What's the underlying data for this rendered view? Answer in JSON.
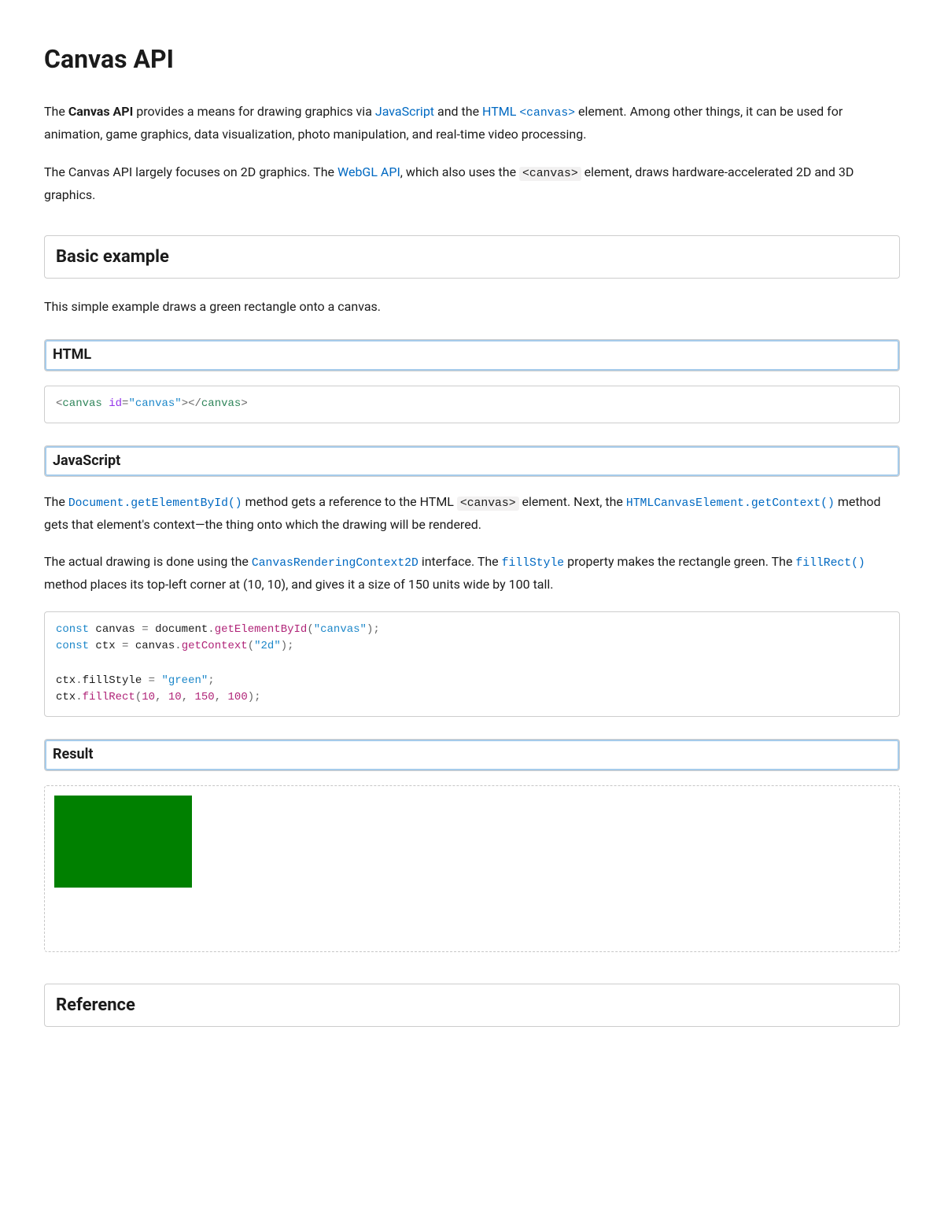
{
  "title": "Canvas API",
  "para1": {
    "t1": "The ",
    "b1": "Canvas API",
    "t2": " provides a means for drawing graphics via ",
    "link_js": "JavaScript",
    "t3": " and the ",
    "link_html": "HTML",
    "t4": " ",
    "code_canvas": "<canvas>",
    "t5": " element. Among other things, it can be used for animation, game graphics, data visualization, photo manipulation, and real-time video processing."
  },
  "para2": {
    "t1": "The Canvas API largely focuses on 2D graphics. The ",
    "link_webgl": "WebGL API",
    "t2": ", which also uses the ",
    "code_canvas": "<canvas>",
    "t3": " element, draws hardware-accelerated 2D and 3D graphics."
  },
  "sec_basic": "Basic example",
  "basic_desc": "This simple example draws a green rectangle onto a canvas.",
  "sub_html": "HTML",
  "code_html": {
    "lt1": "<",
    "tag1": "canvas",
    "sp1": " ",
    "attr1": "id",
    "eq": "=",
    "q": "\"",
    "val1": "canvas",
    "gt1": ">",
    "lt2": "</",
    "tag2": "canvas",
    "gt2": ">"
  },
  "sub_js": "JavaScript",
  "js_para1": {
    "t1": "The ",
    "c1": "Document.getElementById()",
    "t2": " method gets a reference to the HTML ",
    "c2": "<canvas>",
    "t3": " element. Next, the ",
    "c3": "HTMLCanvasElement.getContext()",
    "t4": " method gets that element's context—the thing onto which the drawing will be rendered."
  },
  "js_para2": {
    "t1": "The actual drawing is done using the ",
    "c1": "CanvasRenderingContext2D",
    "t2": " interface. The ",
    "c2": "fillStyle",
    "t3": " property makes the rectangle green. The ",
    "c3": "fillRect()",
    "t4": " method places its top-left corner at (10, 10), and gives it a size of 150 units wide by 100 tall."
  },
  "code_js": {
    "l1": {
      "kw": "const",
      "sp1": " ",
      "v1": "canvas",
      "sp2": " = ",
      "v2": "document",
      "dot": ".",
      "fn": "getElementById",
      "p1": "(",
      "q": "\"",
      "s": "canvas",
      "p2": ");"
    },
    "l2": {
      "kw": "const",
      "sp1": " ",
      "v1": "ctx",
      "sp2": " = ",
      "v2": "canvas",
      "dot": ".",
      "fn": "getContext",
      "p1": "(",
      "q": "\"",
      "s": "2d",
      "p2": ");"
    },
    "l4": {
      "v1": "ctx",
      "dot": ".",
      "prop": "fillStyle",
      "sp": " = ",
      "q": "\"",
      "s": "green",
      "end": ";"
    },
    "l5": {
      "v1": "ctx",
      "dot": ".",
      "fn": "fillRect",
      "p1": "(",
      "n1": "10",
      "c": ", ",
      "n2": "10",
      "n3": "150",
      "n4": "100",
      "p2": ");"
    }
  },
  "sub_result": "Result",
  "sec_reference": "Reference",
  "result_rect": {
    "color": "#008000"
  }
}
